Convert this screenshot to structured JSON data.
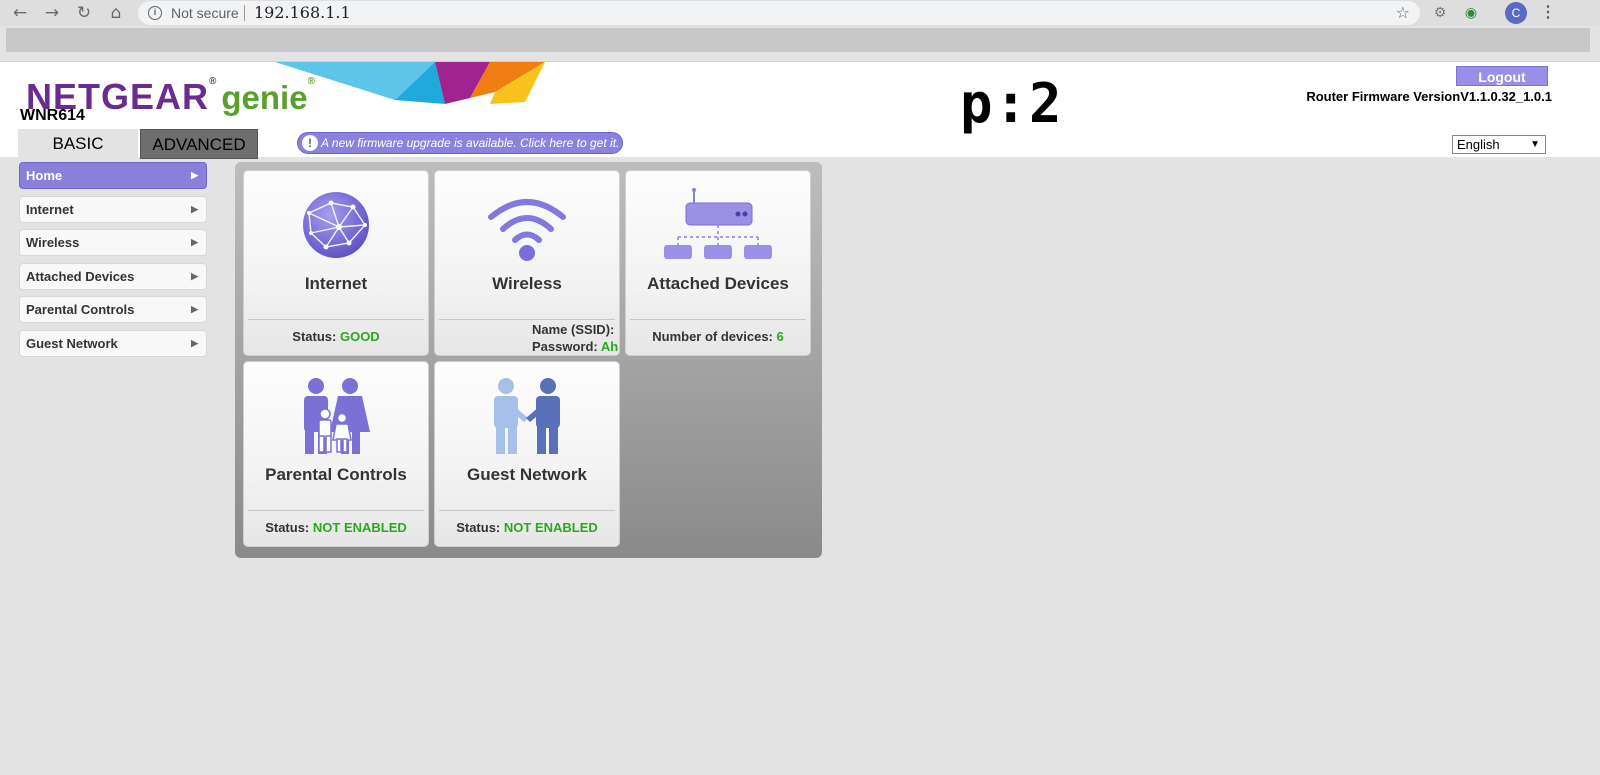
{
  "browser": {
    "security_label": "Not secure",
    "url": "192.168.1.1",
    "avatar_letter": "C"
  },
  "header": {
    "brand": "NETGEAR",
    "brand_reg": "®",
    "product": "genie",
    "product_reg": "®",
    "model": "WNR614",
    "overlay_text": "p:2",
    "logout_label": "Logout",
    "firmware_version": "Router Firmware VersionV1.1.0.32_1.0.1",
    "tabs": [
      {
        "label": "BASIC",
        "selected": true
      },
      {
        "label": "ADVANCED",
        "selected": false
      }
    ],
    "firmware_notice": "A new firmware upgrade is available. Click here to get it.",
    "language": "English"
  },
  "sidebar": {
    "items": [
      {
        "label": "Home",
        "active": true
      },
      {
        "label": "Internet",
        "active": false
      },
      {
        "label": "Wireless",
        "active": false
      },
      {
        "label": "Attached Devices",
        "active": false
      },
      {
        "label": "Parental Controls",
        "active": false
      },
      {
        "label": "Guest Network",
        "active": false
      }
    ]
  },
  "tiles": {
    "internet": {
      "title": "Internet",
      "status_label": "Status:",
      "status_value": "GOOD"
    },
    "wireless": {
      "title": "Wireless",
      "ssid_label": "Name (SSID):",
      "password_label": "Password:",
      "password_value": "Ah"
    },
    "attached": {
      "title": "Attached Devices",
      "count_label": "Number of devices:",
      "count_value": "6"
    },
    "parental": {
      "title": "Parental Controls",
      "status_label": "Status:",
      "status_value": "NOT ENABLED"
    },
    "guest": {
      "title": "Guest Network",
      "status_label": "Status:",
      "status_value": "NOT ENABLED"
    }
  },
  "colors": {
    "brand_purple": "#6b2c8f",
    "genie_green": "#5aa02c",
    "accent_lavender": "#8a7fdb",
    "status_green": "#2aa81e"
  },
  "icons": [
    "back-arrow-icon",
    "forward-arrow-icon",
    "reload-icon",
    "home-icon",
    "info-icon",
    "star-icon",
    "globe-icon",
    "wifi-icon",
    "router-icon",
    "family-icon",
    "handshake-icon"
  ]
}
